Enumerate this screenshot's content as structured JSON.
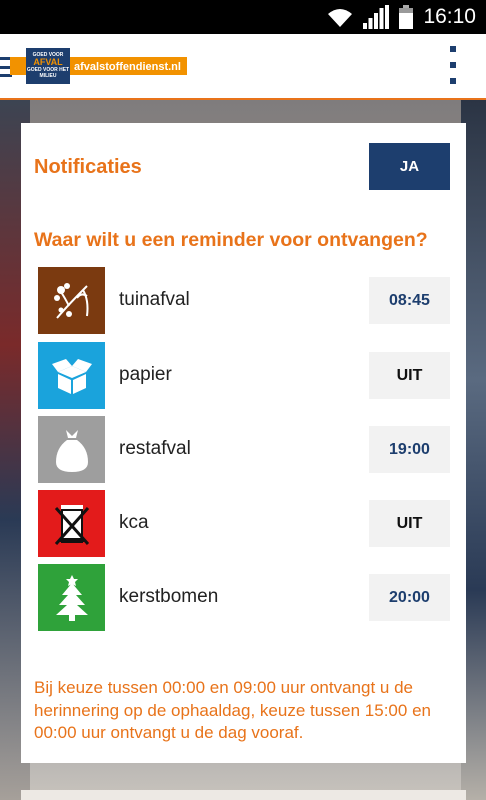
{
  "status_bar": {
    "time": "16:10"
  },
  "app_bar": {
    "logo_text": "afvalstoffendienst.nl",
    "logo_tag_top": "GOED VOOR",
    "logo_tag_mid": "AFVAL",
    "logo_tag_small": "GOED VOOR HET",
    "logo_tag_bottom": "MILIEU"
  },
  "card": {
    "notifications_label": "Notificaties",
    "notifications_toggle": "JA",
    "question": "Waar wilt u een reminder voor ontvangen?",
    "items": [
      {
        "label": "tuinafval",
        "value": "08:45",
        "color": "#7b3a10",
        "icon": "garden-waste-icon"
      },
      {
        "label": "papier",
        "value": "UIT",
        "color": "#1aa3dc",
        "icon": "paper-box-icon"
      },
      {
        "label": "restafval",
        "value": "19:00",
        "color": "#9e9e9e",
        "icon": "waste-bag-icon"
      },
      {
        "label": "kca",
        "value": "UIT",
        "color": "#e31b1b",
        "icon": "chemical-waste-icon"
      },
      {
        "label": "kerstbomen",
        "value": "20:00",
        "color": "#2fa23a",
        "icon": "christmas-tree-icon"
      }
    ],
    "footnote": "Bij keuze tussen 00:00 en 09:00 uur ontvangt u de herinnering op de ophaaldag, keuze tussen 15:00 en 00:00 uur ontvangt u de dag vooraf."
  },
  "colors": {
    "accent": "#e8731a",
    "brand": "#1d3e6e"
  }
}
